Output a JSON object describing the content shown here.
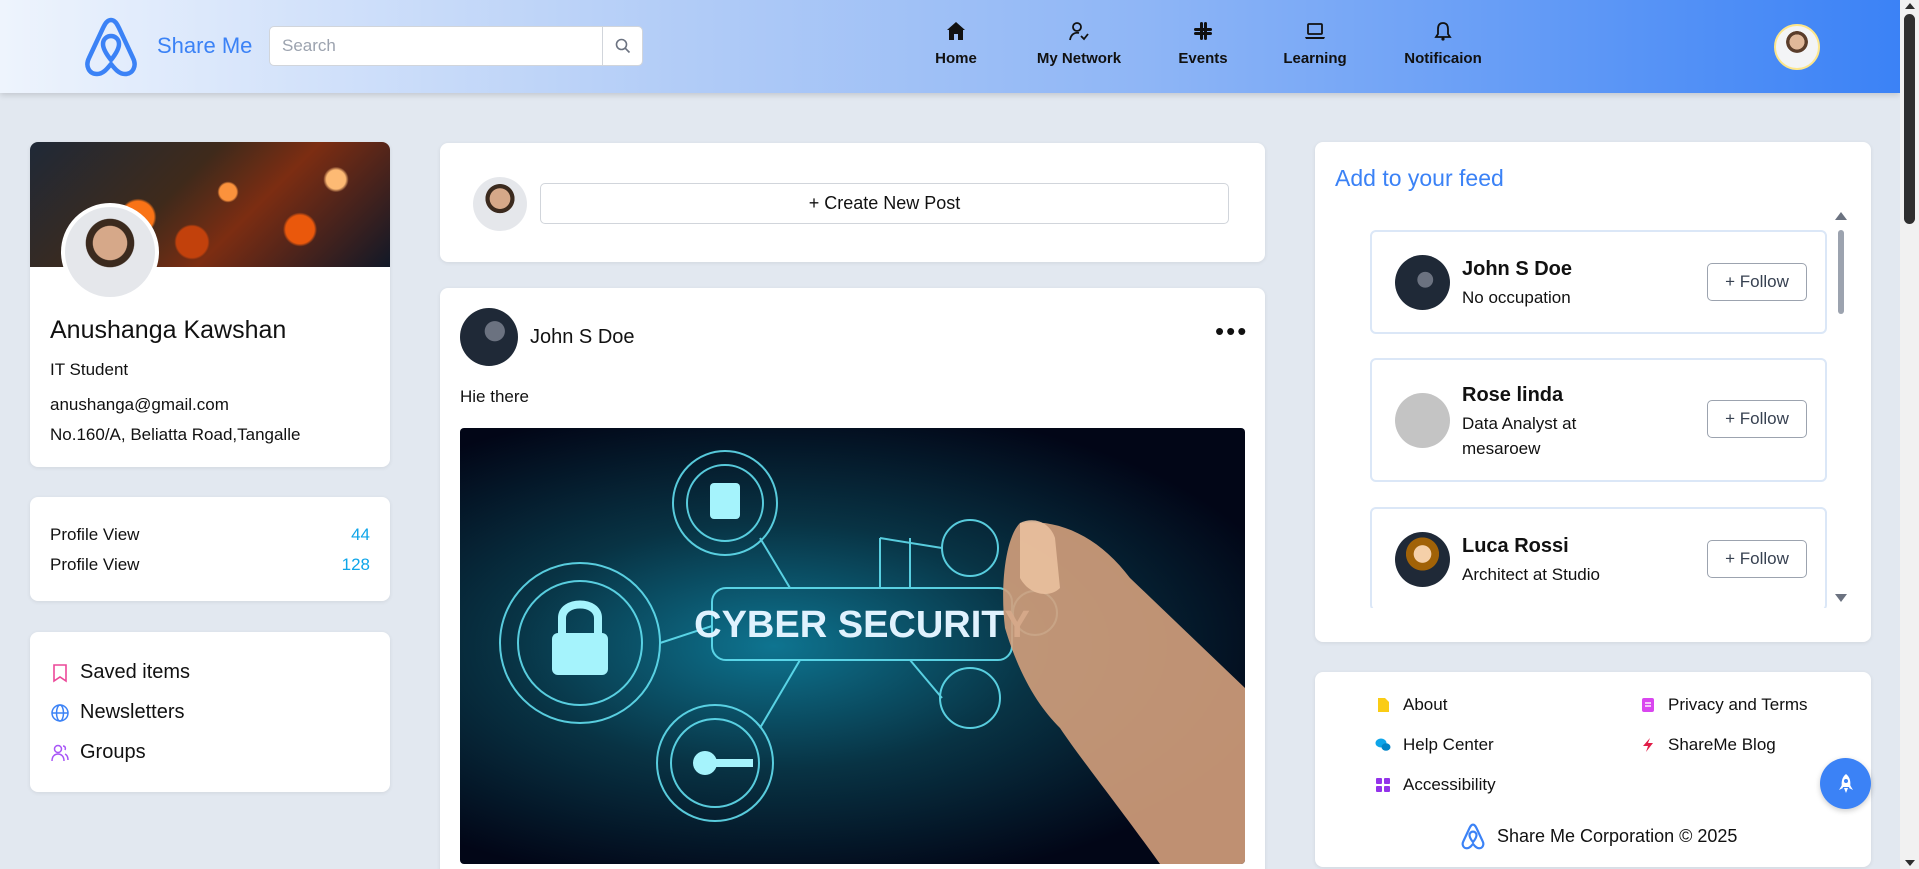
{
  "header": {
    "brand": "Share Me",
    "search_placeholder": "Search",
    "nav": [
      {
        "label": "Home",
        "icon": "home-icon"
      },
      {
        "label": "My Network",
        "icon": "network-icon"
      },
      {
        "label": "Events",
        "icon": "events-icon"
      },
      {
        "label": "Learning",
        "icon": "laptop-icon"
      },
      {
        "label": "Notificaion",
        "icon": "bell-icon"
      }
    ]
  },
  "profile": {
    "name": "Anushanga Kawshan",
    "title": "IT Student",
    "email": "anushanga@gmail.com",
    "address": "No.160/A, Beliatta Road,Tangalle"
  },
  "stats": [
    {
      "label": "Profile View",
      "value": "44"
    },
    {
      "label": "Profile View",
      "value": "128"
    }
  ],
  "links": [
    {
      "label": "Saved items",
      "icon": "bookmark-icon",
      "color": "#ec4899"
    },
    {
      "label": "Newsletters",
      "icon": "globe-icon",
      "color": "#3b82f6"
    },
    {
      "label": "Groups",
      "icon": "groups-icon",
      "color": "#a855f7"
    }
  ],
  "create_post": {
    "label": "+ Create New Post"
  },
  "post": {
    "author": "John S Doe",
    "text": "Hie there",
    "image_caption": "CYBER SECURITY"
  },
  "feed": {
    "title": "Add to your feed",
    "follow_label": "+ Follow",
    "people": [
      {
        "name": "John S Doe",
        "occupation": "No occupation"
      },
      {
        "name": "Rose linda",
        "occupation": "Data Analyst at mesaroew"
      },
      {
        "name": "Luca Rossi",
        "occupation": "Architect at Studio"
      }
    ]
  },
  "footer": {
    "links": [
      {
        "label": "About",
        "icon": "document-icon",
        "color": "#facc15"
      },
      {
        "label": "Privacy and Terms",
        "icon": "policy-icon",
        "color": "#d946ef"
      },
      {
        "label": "Help Center",
        "icon": "chat-icon",
        "color": "#0ea5e9"
      },
      {
        "label": "ShareMe Blog",
        "icon": "bolt-icon",
        "color": "#e11d48"
      },
      {
        "label": "Accessibility",
        "icon": "grid-icon",
        "color": "#9333ea"
      }
    ],
    "copyright": "Share Me Corporation © 2025"
  },
  "colors": {
    "accent": "#3b82f6",
    "stat_value": "#0ea5e9"
  }
}
